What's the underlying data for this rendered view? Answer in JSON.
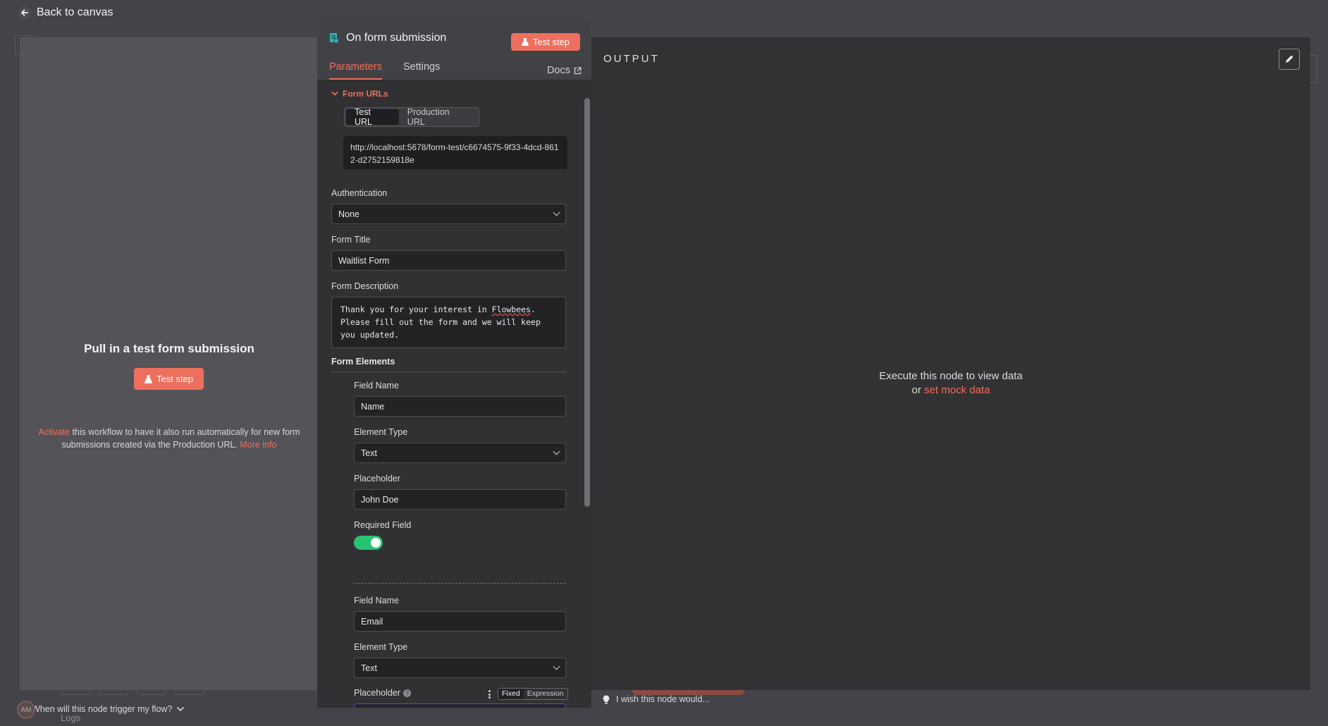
{
  "header": {
    "back_label": "Back to canvas"
  },
  "input_panel": {
    "title": "Pull in a test form submission",
    "test_button": "Test step",
    "activate_link": "Activate",
    "info_text": " this workflow to have it also run automatically for new form submissions created via the Production URL. ",
    "more_info_link": "More info",
    "trigger_question": "When will this node trigger my flow?"
  },
  "node": {
    "title": "On form submission",
    "test_button": "Test step",
    "tabs": [
      "Parameters",
      "Settings"
    ],
    "docs_label": "Docs",
    "form_urls": {
      "label": "Form URLs",
      "options": [
        "Test URL",
        "Production URL"
      ],
      "selected": "Test URL",
      "url": "http://localhost:5678/form-test/c6674575-9f33-4dcd-8612-d2752159818e"
    },
    "authentication": {
      "label": "Authentication",
      "value": "None"
    },
    "form_title": {
      "label": "Form Title",
      "value": "Waitlist Form"
    },
    "form_description": {
      "label": "Form Description",
      "before": "Thank you for your interest in ",
      "misspelled": "Flowbees",
      "after": ". Please fill out the form and we will keep you updated."
    },
    "form_elements": {
      "label": "Form Elements",
      "items": [
        {
          "field_name_label": "Field Name",
          "field_name": "Name",
          "element_type_label": "Element Type",
          "element_type": "Text",
          "placeholder_label": "Placeholder",
          "placeholder": "John Doe",
          "required_label": "Required Field",
          "required": true
        },
        {
          "field_name_label": "Field Name",
          "field_name": "Email",
          "element_type_label": "Element Type",
          "element_type": "Text",
          "placeholder_label": "Placeholder"
        }
      ]
    },
    "fixed_label": "Fixed",
    "expression_label": "Expression"
  },
  "output": {
    "title": "OUTPUT",
    "message_line1": "Execute this node to view data",
    "message_or": "or ",
    "mock_link": "set mock data"
  },
  "feedback": "I wish this node would...",
  "logs_label": "Logs",
  "avatar_initials": "AM",
  "colors": {
    "accent": "#ee6f5e",
    "toggle_on": "#27c272",
    "panel_bg": "#313134"
  }
}
